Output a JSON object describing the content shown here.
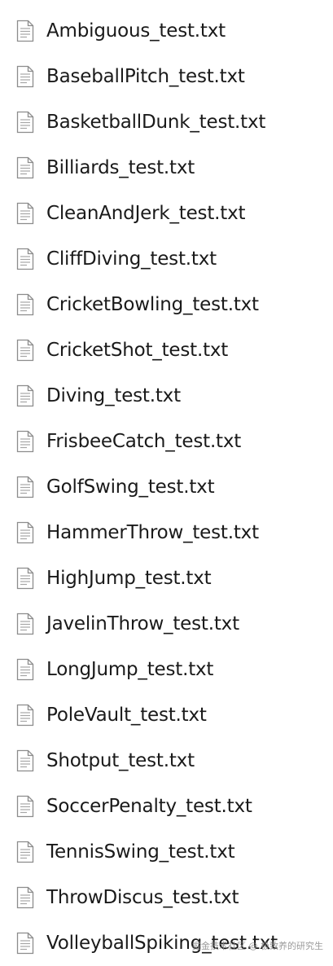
{
  "files": [
    {
      "name": "Ambiguous_test.txt",
      "icon": "text-file-icon"
    },
    {
      "name": "BaseballPitch_test.txt",
      "icon": "text-file-icon"
    },
    {
      "name": "BasketballDunk_test.txt",
      "icon": "text-file-icon"
    },
    {
      "name": "Billiards_test.txt",
      "icon": "text-file-icon"
    },
    {
      "name": "CleanAndJerk_test.txt",
      "icon": "text-file-icon"
    },
    {
      "name": "CliffDiving_test.txt",
      "icon": "text-file-icon"
    },
    {
      "name": "CricketBowling_test.txt",
      "icon": "text-file-icon"
    },
    {
      "name": "CricketShot_test.txt",
      "icon": "text-file-icon"
    },
    {
      "name": "Diving_test.txt",
      "icon": "text-file-icon"
    },
    {
      "name": "FrisbeeCatch_test.txt",
      "icon": "text-file-icon"
    },
    {
      "name": "GolfSwing_test.txt",
      "icon": "text-file-icon"
    },
    {
      "name": "HammerThrow_test.txt",
      "icon": "text-file-icon"
    },
    {
      "name": "HighJump_test.txt",
      "icon": "text-file-icon"
    },
    {
      "name": "JavelinThrow_test.txt",
      "icon": "text-file-icon"
    },
    {
      "name": "LongJump_test.txt",
      "icon": "text-file-icon"
    },
    {
      "name": "PoleVault_test.txt",
      "icon": "text-file-icon"
    },
    {
      "name": "Shotput_test.txt",
      "icon": "text-file-icon"
    },
    {
      "name": "SoccerPenalty_test.txt",
      "icon": "text-file-icon"
    },
    {
      "name": "TennisSwing_test.txt",
      "icon": "text-file-icon"
    },
    {
      "name": "ThrowDiscus_test.txt",
      "icon": "text-file-icon"
    },
    {
      "name": "VolleyballSpiking_test.txt",
      "icon": "text-file-icon"
    }
  ],
  "watermark": "掘金技术社区 @ 极致养的研究生",
  "colors": {
    "text": "#1a1a1a",
    "icon_stroke": "#8c8c8c",
    "icon_lines": "#a6a6a6",
    "background": "#ffffff"
  }
}
